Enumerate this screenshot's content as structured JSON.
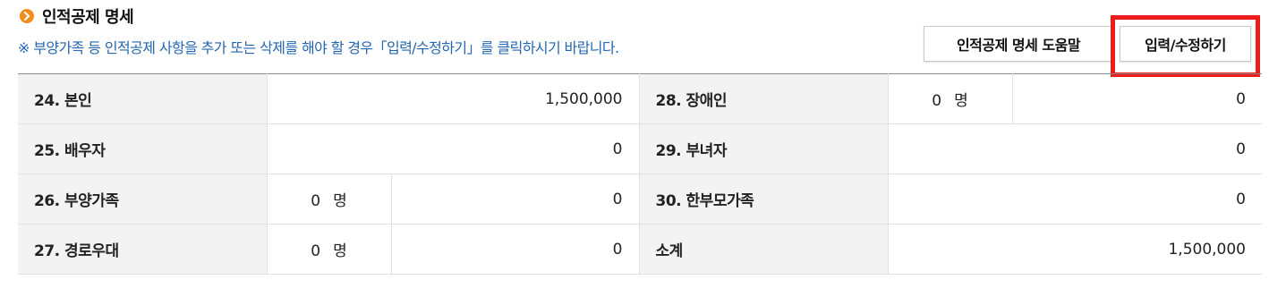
{
  "section": {
    "title": "인적공제 명세",
    "notice": "※ 부양가족 등 인적공제 사항을 추가 또는 삭제를 해야 할 경우「입력/수정하기」를 클릭하시기 바랍니다."
  },
  "buttons": {
    "help": "인적공제 명세 도움말",
    "edit": "입력/수정하기"
  },
  "unit": "명",
  "rows": [
    {
      "left": {
        "label": "24. 본인",
        "amount": "1,500,000"
      },
      "right": {
        "label": "28. 장애인",
        "count": "0",
        "amount": "0"
      }
    },
    {
      "left": {
        "label": "25. 배우자",
        "amount": "0"
      },
      "right": {
        "label": "29. 부녀자",
        "amount": "0"
      }
    },
    {
      "left": {
        "label": "26. 부양가족",
        "count": "0",
        "amount": "0"
      },
      "right": {
        "label": "30. 한부모가족",
        "amount": "0"
      }
    },
    {
      "left": {
        "label": "27. 경로우대",
        "count": "0",
        "amount": "0"
      },
      "right": {
        "label": "소계",
        "amount": "1,500,000"
      }
    }
  ],
  "colors": {
    "bullet": "#f28c1c",
    "notice": "#2466b1",
    "highlight": "#ef1c1c",
    "label_bg": "#f3f3f3"
  },
  "icons": {
    "bullet": "chevron-right-circle-icon"
  }
}
